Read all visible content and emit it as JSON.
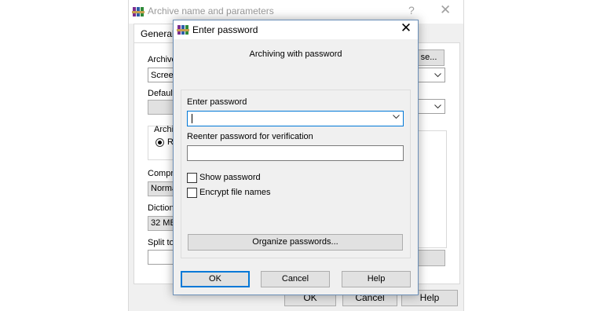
{
  "background_window": {
    "title": "Archive name and parameters",
    "help_glyph": "?",
    "close_glyph": "✕",
    "tab_general": "General",
    "label_archive": "Archive",
    "archive_value": "Screen",
    "browse_fragment": "se...",
    "label_default": "Default",
    "label_archive_format": "Archiv",
    "radio_rar": "RA",
    "label_compression": "Compre",
    "compression_value": "Norma",
    "label_dictionary": "Dictiona",
    "dictionary_value": "32 MB",
    "label_split": "Split to",
    "ok": "OK",
    "cancel": "Cancel",
    "help": "Help"
  },
  "dialog": {
    "title": "Enter password",
    "close_glyph": "✕",
    "subtitle": "Archiving with password",
    "enter_password_label": "Enter password",
    "password_value": "",
    "reenter_label": "Reenter password for verification",
    "reenter_value": "",
    "show_password_label": "Show password",
    "show_password_checked": false,
    "encrypt_names_label": "Encrypt file names",
    "encrypt_names_checked": false,
    "organize_button": "Organize passwords...",
    "ok_button": "OK",
    "cancel_button": "Cancel",
    "help_button": "Help"
  },
  "colors": {
    "focus_accent": "#0078d7",
    "button_face": "#e1e1e1",
    "dialog_bg": "#f0f0f0"
  },
  "icons": {
    "app": "winrar-books-icon",
    "dropdown": "chevron-down-icon"
  }
}
